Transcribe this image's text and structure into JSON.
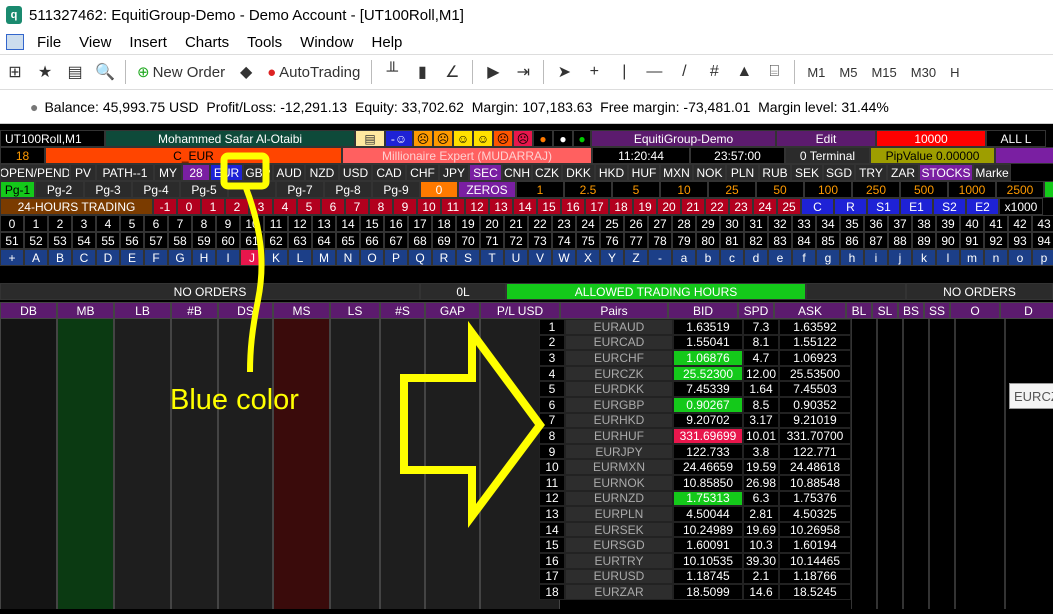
{
  "window": {
    "title": "511327462: EquitiGroup-Demo - Demo Account - [UT100Roll,M1]",
    "app_icon": "q"
  },
  "menu": [
    "File",
    "View",
    "Insert",
    "Charts",
    "Tools",
    "Window",
    "Help"
  ],
  "toolbar": {
    "new_order": "New Order",
    "autotrading": "AutoTrading",
    "timeframes": [
      "M1",
      "M5",
      "M15",
      "M30",
      "H"
    ]
  },
  "status": {
    "text": "Balance: 45,993.75 USD  Profit/Loss: -12,291.13  Equity: 33,702.62  Margin: 107,183.63  Free margin: -73,481.01  Margin level: 31.44%"
  },
  "panel": {
    "row1": {
      "symbol": "UT100Roll,M1",
      "name": "Mohammed Safar Al-Otaibi",
      "server": "EquitiGroup-Demo",
      "edit": "Edit",
      "amount": "10000",
      "all": "ALL L"
    },
    "row2": {
      "num": "18",
      "ceur": "C_EUR",
      "expert": "Millionaire Expert (MUDARRAJ)",
      "time1": "11:20:44",
      "time2": "23:57:00",
      "terminal": "0 Terminal",
      "pipvalue": "PipValue 0.00000"
    },
    "row3": [
      "OPEN/PEND",
      "PV",
      "PATH--1",
      "MY",
      "28",
      "EUR",
      "GBP",
      "AUD",
      "NZD",
      "USD",
      "CAD",
      "CHF",
      "JPY",
      "SEC",
      "CNH",
      "CZK",
      "DKK",
      "HKD",
      "HUF",
      "MXN",
      "NOK",
      "PLN",
      "RUB",
      "SEK",
      "SGD",
      "TRY",
      "ZAR",
      "STOCKS",
      "Marke"
    ],
    "row4_pages": [
      "Pg-1",
      "Pg-2",
      "Pg-3",
      "Pg-4",
      "Pg-5",
      "",
      "Pg-7",
      "Pg-8",
      "Pg-9"
    ],
    "row4_rest": [
      "0",
      "ZEROS",
      "1",
      "2.5",
      "5",
      "10",
      "25",
      "50",
      "100",
      "250",
      "500",
      "1000",
      "2500",
      ""
    ],
    "row5": [
      "24-HOURS TRADING",
      "-1",
      "0",
      "1",
      "2",
      "3",
      "4",
      "5",
      "6",
      "7",
      "8",
      "9",
      "10",
      "11",
      "12",
      "13",
      "14",
      "15",
      "16",
      "17",
      "18",
      "19",
      "20",
      "21",
      "22",
      "23",
      "24",
      "25",
      "C",
      "R",
      "S1",
      "E1",
      "S2",
      "E2",
      "x1000"
    ],
    "row6": [
      "0",
      "1",
      "2",
      "3",
      "4",
      "5",
      "6",
      "7",
      "8",
      "9",
      "10",
      "11",
      "12",
      "13",
      "14",
      "15",
      "16",
      "17",
      "18",
      "19",
      "20",
      "21",
      "22",
      "23",
      "24",
      "25",
      "26",
      "27",
      "28",
      "29",
      "30",
      "31",
      "32",
      "33",
      "34",
      "35",
      "36",
      "37",
      "38",
      "39",
      "40",
      "41",
      "42",
      "43"
    ],
    "row7": [
      "51",
      "52",
      "53",
      "54",
      "55",
      "56",
      "57",
      "58",
      "59",
      "60",
      "61",
      "62",
      "63",
      "64",
      "65",
      "66",
      "67",
      "68",
      "69",
      "70",
      "71",
      "72",
      "73",
      "74",
      "75",
      "76",
      "77",
      "78",
      "79",
      "80",
      "81",
      "82",
      "83",
      "84",
      "85",
      "86",
      "87",
      "88",
      "89",
      "90",
      "91",
      "92",
      "93",
      "94"
    ],
    "row8": [
      "+",
      "A",
      "B",
      "C",
      "D",
      "E",
      "F",
      "G",
      "H",
      "I",
      "J",
      "K",
      "L",
      "M",
      "N",
      "O",
      "P",
      "Q",
      "R",
      "S",
      "T",
      "U",
      "V",
      "W",
      "X",
      "Y",
      "Z",
      "-",
      "a",
      "b",
      "c",
      "d",
      "e",
      "f",
      "g",
      "h",
      "i",
      "j",
      "k",
      "l",
      "m",
      "n",
      "o",
      "p"
    ],
    "orders": {
      "left": "NO ORDERS",
      "zero": "0L",
      "allowed": "ALLOWED TRADING HOURS",
      "right": "NO ORDERS"
    },
    "headers": [
      "DB",
      "MB",
      "LB",
      "#B",
      "DS",
      "MS",
      "LS",
      "#S",
      "GAP",
      "P/L USD",
      "Pairs",
      "BID",
      "SPD",
      "ASK",
      "BL",
      "SL",
      "BS",
      "SS",
      "O",
      "D"
    ],
    "pairs": [
      {
        "n": "1",
        "pair": "EURAUD",
        "bid": "1.63519",
        "spd": "7.3",
        "ask": "1.63592",
        "hl": ""
      },
      {
        "n": "2",
        "pair": "EURCAD",
        "bid": "1.55041",
        "spd": "8.1",
        "ask": "1.55122",
        "hl": ""
      },
      {
        "n": "3",
        "pair": "EURCHF",
        "bid": "1.06876",
        "spd": "4.7",
        "ask": "1.06923",
        "hl": "green"
      },
      {
        "n": "4",
        "pair": "EURCZK",
        "bid": "25.52300",
        "spd": "12.00",
        "ask": "25.53500",
        "hl": "green"
      },
      {
        "n": "5",
        "pair": "EURDKK",
        "bid": "7.45339",
        "spd": "1.64",
        "ask": "7.45503",
        "hl": ""
      },
      {
        "n": "6",
        "pair": "EURGBP",
        "bid": "0.90267",
        "spd": "8.5",
        "ask": "0.90352",
        "hl": "green"
      },
      {
        "n": "7",
        "pair": "EURHKD",
        "bid": "9.20702",
        "spd": "3.17",
        "ask": "9.21019",
        "hl": ""
      },
      {
        "n": "8",
        "pair": "EURHUF",
        "bid": "331.69699",
        "spd": "10.01",
        "ask": "331.70700",
        "hl": "red"
      },
      {
        "n": "9",
        "pair": "EURJPY",
        "bid": "122.733",
        "spd": "3.8",
        "ask": "122.771",
        "hl": ""
      },
      {
        "n": "10",
        "pair": "EURMXN",
        "bid": "24.46659",
        "spd": "19.59",
        "ask": "24.48618",
        "hl": ""
      },
      {
        "n": "11",
        "pair": "EURNOK",
        "bid": "10.85850",
        "spd": "26.98",
        "ask": "10.88548",
        "hl": ""
      },
      {
        "n": "12",
        "pair": "EURNZD",
        "bid": "1.75313",
        "spd": "6.3",
        "ask": "1.75376",
        "hl": "green"
      },
      {
        "n": "13",
        "pair": "EURPLN",
        "bid": "4.50044",
        "spd": "2.81",
        "ask": "4.50325",
        "hl": ""
      },
      {
        "n": "14",
        "pair": "EURSEK",
        "bid": "10.24989",
        "spd": "19.69",
        "ask": "10.26958",
        "hl": ""
      },
      {
        "n": "15",
        "pair": "EURSGD",
        "bid": "1.60091",
        "spd": "10.3",
        "ask": "1.60194",
        "hl": ""
      },
      {
        "n": "16",
        "pair": "EURTRY",
        "bid": "10.10535",
        "spd": "39.30",
        "ask": "10.14465",
        "hl": ""
      },
      {
        "n": "17",
        "pair": "EURUSD",
        "bid": "1.18745",
        "spd": "2.1",
        "ask": "1.18766",
        "hl": ""
      },
      {
        "n": "18",
        "pair": "EURZAR",
        "bid": "18.5099",
        "spd": "14.6",
        "ask": "18.5245",
        "hl": ""
      }
    ]
  },
  "annotation": {
    "label": "Blue color",
    "tooltip": "EURCZ"
  },
  "colors": {
    "annotation": "#ffff00",
    "selected_currency": "#1e22d6",
    "green_cell": "#14c91a",
    "red_cell": "#e8164c"
  }
}
